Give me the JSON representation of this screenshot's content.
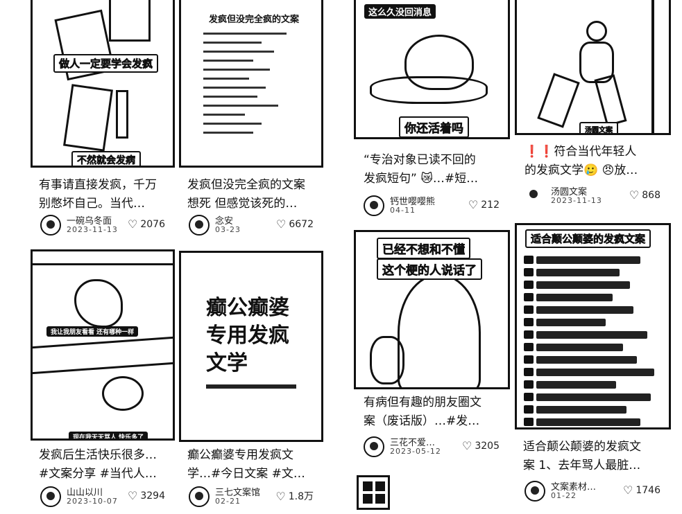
{
  "cards": [
    {
      "caption": "有事请直接发疯，千万\n别憋坏自己。当代…",
      "overlay_top": "做人一定要学会发疯",
      "overlay_bottom": "不然就会发病",
      "author": "一碗乌冬面",
      "date": "2023-11-13",
      "likes": "2076"
    },
    {
      "caption": "发疯但没完全疯的文案\n想死 但感觉该死的…",
      "doc_title": "发疯但没完全疯的文案",
      "author": "念安",
      "date": "03-23",
      "likes": "6672"
    },
    {
      "caption": "“专治对象已读不回的\n发疯短句” 😿…#短…",
      "overlay_top": "这么久没回消息",
      "overlay_bottom": "你还活着吗",
      "author": "钙世嘤嘤熊",
      "date": "04-11",
      "likes": "212"
    },
    {
      "caption": "❗❗符合当代年轻人\n的发疯文学🥲 😠放…",
      "overlay_bottom": "汤圆文案",
      "author": "汤圆文案",
      "date": "2023-11-13",
      "likes": "868"
    },
    {
      "caption": "发疯后生活快乐很多…\n#文案分享 #当代人…",
      "overlay_mid": "我让我朋友看看 还有哪种一样",
      "overlay_bottom": "现在我天天骂人 快乐多了",
      "author": "山山以川",
      "date": "2023-10-07",
      "likes": "3294"
    },
    {
      "caption": "癫公癫婆专用发疯文\n学…#今日文案 #文…",
      "cover_lines": [
        "癫公癫婆",
        "专用发疯",
        "文学"
      ],
      "author": "三七文案馆",
      "date": "02-21",
      "likes": "1.8万"
    },
    {
      "caption": "有病但有趣的朋友圈文\n案（废话版）…#发…",
      "overlay_top": "已经不想和不懂",
      "overlay_top2": "这个梗的人说话了",
      "author": "三花不爱…",
      "date": "2023-05-12",
      "likes": "3205"
    },
    {
      "caption": "适合颠公颠婆的发疯文\n案 1、去年骂人最脏…",
      "list_title": "适合颠公颠婆的发疯文案",
      "author": "文案素材…",
      "date": "01-22",
      "likes": "1746"
    }
  ],
  "icons": {
    "like": "heart-outline-icon"
  }
}
